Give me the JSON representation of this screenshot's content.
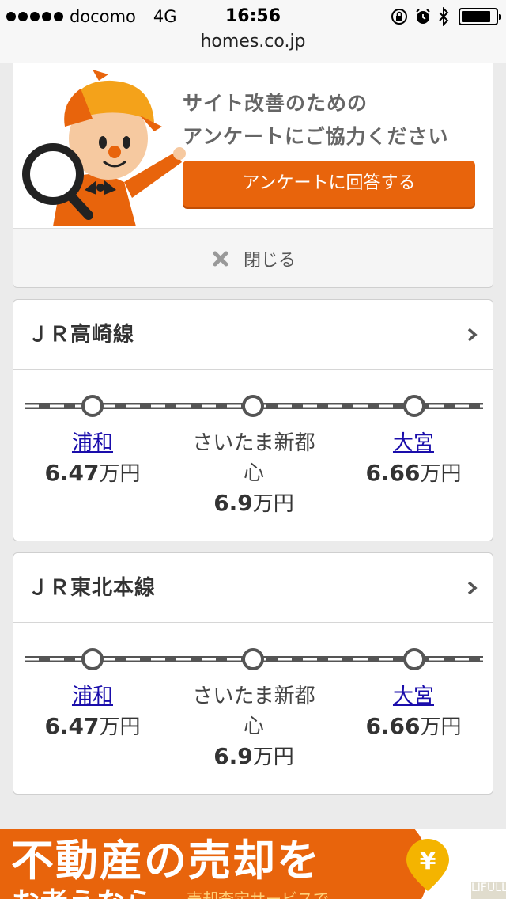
{
  "statusbar": {
    "carrier": "docomo",
    "network": "4G",
    "time": "16:56",
    "battery_level": 0.85,
    "url": "homes.co.jp"
  },
  "survey": {
    "line1": "サイト改善のための",
    "line2": "アンケートにご協力ください",
    "button_label": "アンケートに回答する",
    "close_label": "閉じる"
  },
  "lines": [
    {
      "title": "ＪＲ高崎線",
      "stations": [
        {
          "name": "浦和",
          "price": "6.47",
          "unit": "万円",
          "link": true
        },
        {
          "name": "さいたま新都心",
          "price": "6.9",
          "unit": "万円",
          "link": false
        },
        {
          "name": "大宮",
          "price": "6.66",
          "unit": "万円",
          "link": true
        }
      ]
    },
    {
      "title": "ＪＲ東北本線",
      "stations": [
        {
          "name": "浦和",
          "price": "6.47",
          "unit": "万円",
          "link": true
        },
        {
          "name": "さいたま新都心",
          "price": "6.9",
          "unit": "万円",
          "link": false
        },
        {
          "name": "大宮",
          "price": "6.66",
          "unit": "万円",
          "link": true
        }
      ]
    }
  ],
  "ad": {
    "headline": "不動産の売却を",
    "subline": "お考えなら",
    "link_text": "売却査定サービスで",
    "pin_symbol": "¥",
    "badge": "LIFULL"
  },
  "colors": {
    "accent": "#e8640c",
    "link": "#1a0dab"
  }
}
